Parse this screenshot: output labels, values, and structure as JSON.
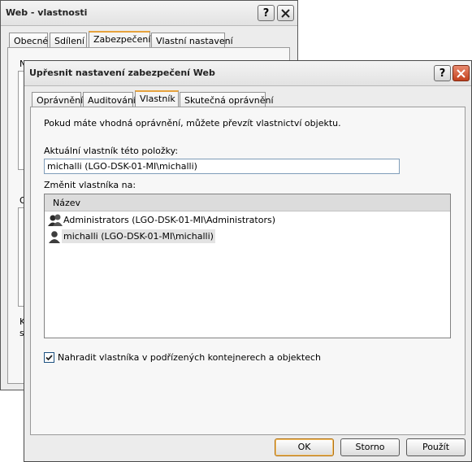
{
  "back_window": {
    "title": "Web - vlastnosti",
    "tabs": [
      "Obecné",
      "Sdílení",
      "Zabezpečení",
      "Vlastní nastavení"
    ],
    "active_tab_index": 2,
    "partial_text": {
      "line1": "N",
      "line2": "O",
      "line3": "K",
      "line4": "s"
    }
  },
  "front_window": {
    "title": "Upřesnit nastavení zabezpečení Web",
    "tabs": [
      "Oprávnění",
      "Auditování",
      "Vlastník",
      "Skutečná oprávnění"
    ],
    "active_tab_index": 2,
    "info_text": "Pokud máte vhodná oprávnění, můžete převzít vlastnictví objektu.",
    "current_owner_label": "Aktuální vlastník této položky:",
    "current_owner_value": "michalli (LGO-DSK-01-MI\\michalli)",
    "change_owner_label": "Změnit vlastníka na:",
    "list_header": "Název",
    "owners": [
      {
        "icon": "user-group-icon",
        "name": "Administrators (LGO-DSK-01-MI\\Administrators)",
        "selected": false
      },
      {
        "icon": "user-icon",
        "name": "michalli (LGO-DSK-01-MI\\michalli)",
        "selected": true
      }
    ],
    "replace_owner_checkbox": {
      "label": "Nahradit vlastníka v podřízených kontejnerech a objektech",
      "checked": true
    },
    "buttons": {
      "ok": "OK",
      "cancel": "Storno",
      "apply": "Použít"
    }
  },
  "colors": {
    "active_tab_accent": "#e6a23d",
    "close_button": "#c3411d",
    "selection": "#e3e3e3"
  }
}
